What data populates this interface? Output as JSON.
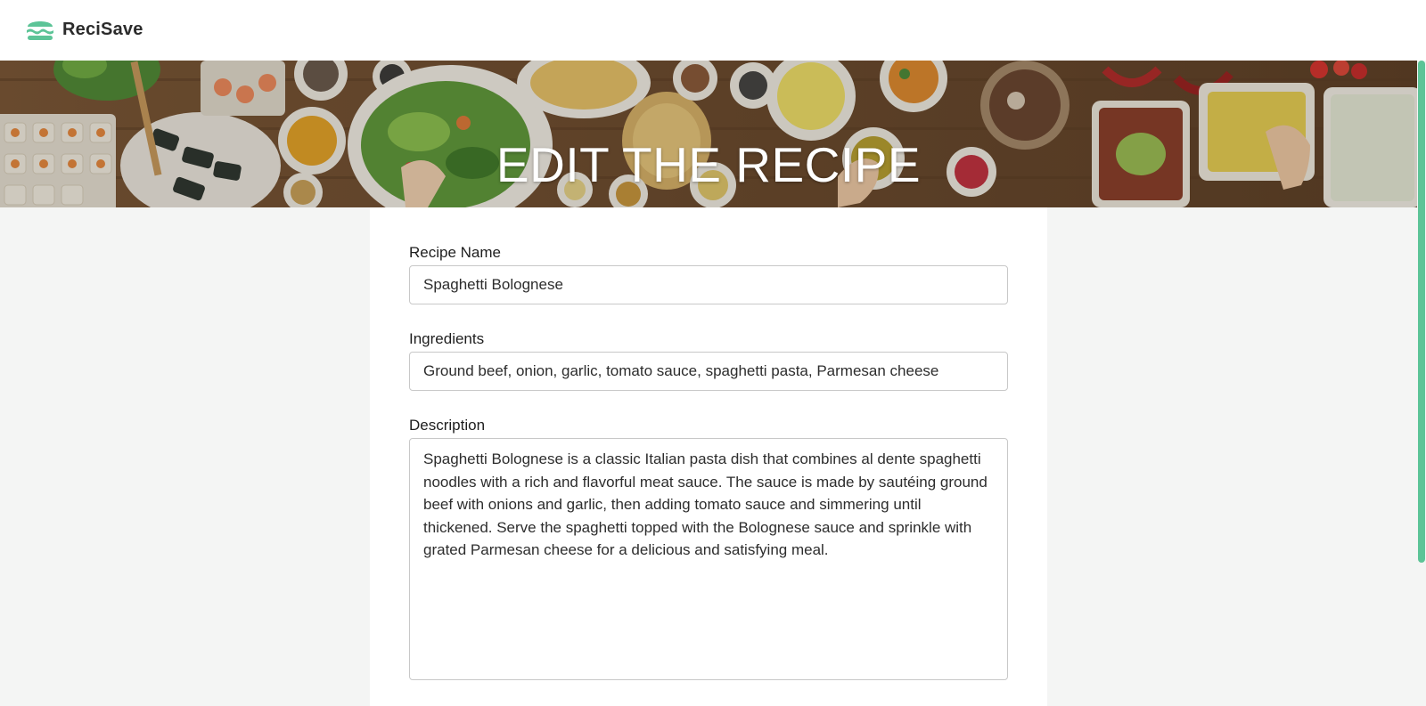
{
  "app": {
    "name": "ReciSave",
    "logo_icon": "burger-icon",
    "accent_color": "#5cc497"
  },
  "hero": {
    "title": "EDIT THE RECIPE",
    "background": "food-table-photo"
  },
  "form": {
    "recipe_name": {
      "label": "Recipe Name",
      "value": "Spaghetti Bolognese"
    },
    "ingredients": {
      "label": "Ingredients",
      "value": "Ground beef, onion, garlic, tomato sauce, spaghetti pasta, Parmesan cheese"
    },
    "description": {
      "label": "Description",
      "value": "Spaghetti Bolognese is a classic Italian pasta dish that combines al dente spaghetti noodles with a rich and flavorful meat sauce. The sauce is made by sautéing ground beef with onions and garlic, then adding tomato sauce and simmering until thickened. Serve the spaghetti topped with the Bolognese sauce and sprinkle with grated Parmesan cheese for a delicious and satisfying meal."
    }
  }
}
